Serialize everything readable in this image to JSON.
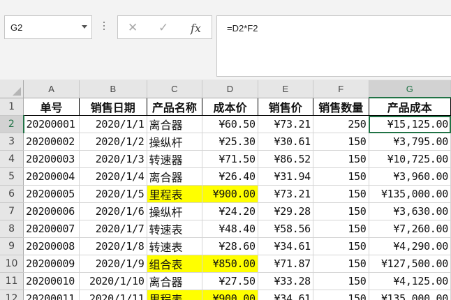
{
  "name_box": {
    "value": "G2"
  },
  "formula_bar": {
    "cancel_icon": "✕",
    "enter_icon": "✓",
    "fx_label": "fx",
    "formula": "=D2*F2"
  },
  "columns": [
    "A",
    "B",
    "C",
    "D",
    "E",
    "F",
    "G"
  ],
  "selected_cell": "G2",
  "header_row": {
    "row": "1",
    "cells": [
      "单号",
      "销售日期",
      "产品名称",
      "成本价",
      "销售价",
      "销售数量",
      "产品成本"
    ]
  },
  "rows": [
    {
      "row": "2",
      "cells": [
        "20200001",
        "2020/1/1",
        "离合器",
        "¥60.50",
        "¥73.21",
        "250",
        "¥15,125.00"
      ],
      "highlight": false
    },
    {
      "row": "3",
      "cells": [
        "20200002",
        "2020/1/2",
        "操纵杆",
        "¥25.30",
        "¥30.61",
        "150",
        "¥3,795.00"
      ],
      "highlight": false
    },
    {
      "row": "4",
      "cells": [
        "20200003",
        "2020/1/3",
        "转速器",
        "¥71.50",
        "¥86.52",
        "150",
        "¥10,725.00"
      ],
      "highlight": false
    },
    {
      "row": "5",
      "cells": [
        "20200004",
        "2020/1/4",
        "离合器",
        "¥26.40",
        "¥31.94",
        "150",
        "¥3,960.00"
      ],
      "highlight": false
    },
    {
      "row": "6",
      "cells": [
        "20200005",
        "2020/1/5",
        "里程表",
        "¥900.00",
        "¥73.21",
        "150",
        "¥135,000.00"
      ],
      "highlight": true
    },
    {
      "row": "7",
      "cells": [
        "20200006",
        "2020/1/6",
        "操纵杆",
        "¥24.20",
        "¥29.28",
        "150",
        "¥3,630.00"
      ],
      "highlight": false
    },
    {
      "row": "8",
      "cells": [
        "20200007",
        "2020/1/7",
        "转速表",
        "¥48.40",
        "¥58.56",
        "150",
        "¥7,260.00"
      ],
      "highlight": false
    },
    {
      "row": "9",
      "cells": [
        "20200008",
        "2020/1/8",
        "转速表",
        "¥28.60",
        "¥34.61",
        "150",
        "¥4,290.00"
      ],
      "highlight": false
    },
    {
      "row": "10",
      "cells": [
        "20200009",
        "2020/1/9",
        "组合表",
        "¥850.00",
        "¥71.87",
        "150",
        "¥127,500.00"
      ],
      "highlight": true
    },
    {
      "row": "11",
      "cells": [
        "20200010",
        "2020/1/10",
        "离合器",
        "¥27.50",
        "¥33.28",
        "150",
        "¥4,125.00"
      ],
      "highlight": false
    },
    {
      "row": "12",
      "cells": [
        "20200011",
        "2020/1/11",
        "里程表",
        "¥900.00",
        "¥34.61",
        "150",
        "¥135,000.00"
      ],
      "highlight": true
    }
  ],
  "colors": {
    "highlight": "#ffff00",
    "selection": "#217346"
  }
}
